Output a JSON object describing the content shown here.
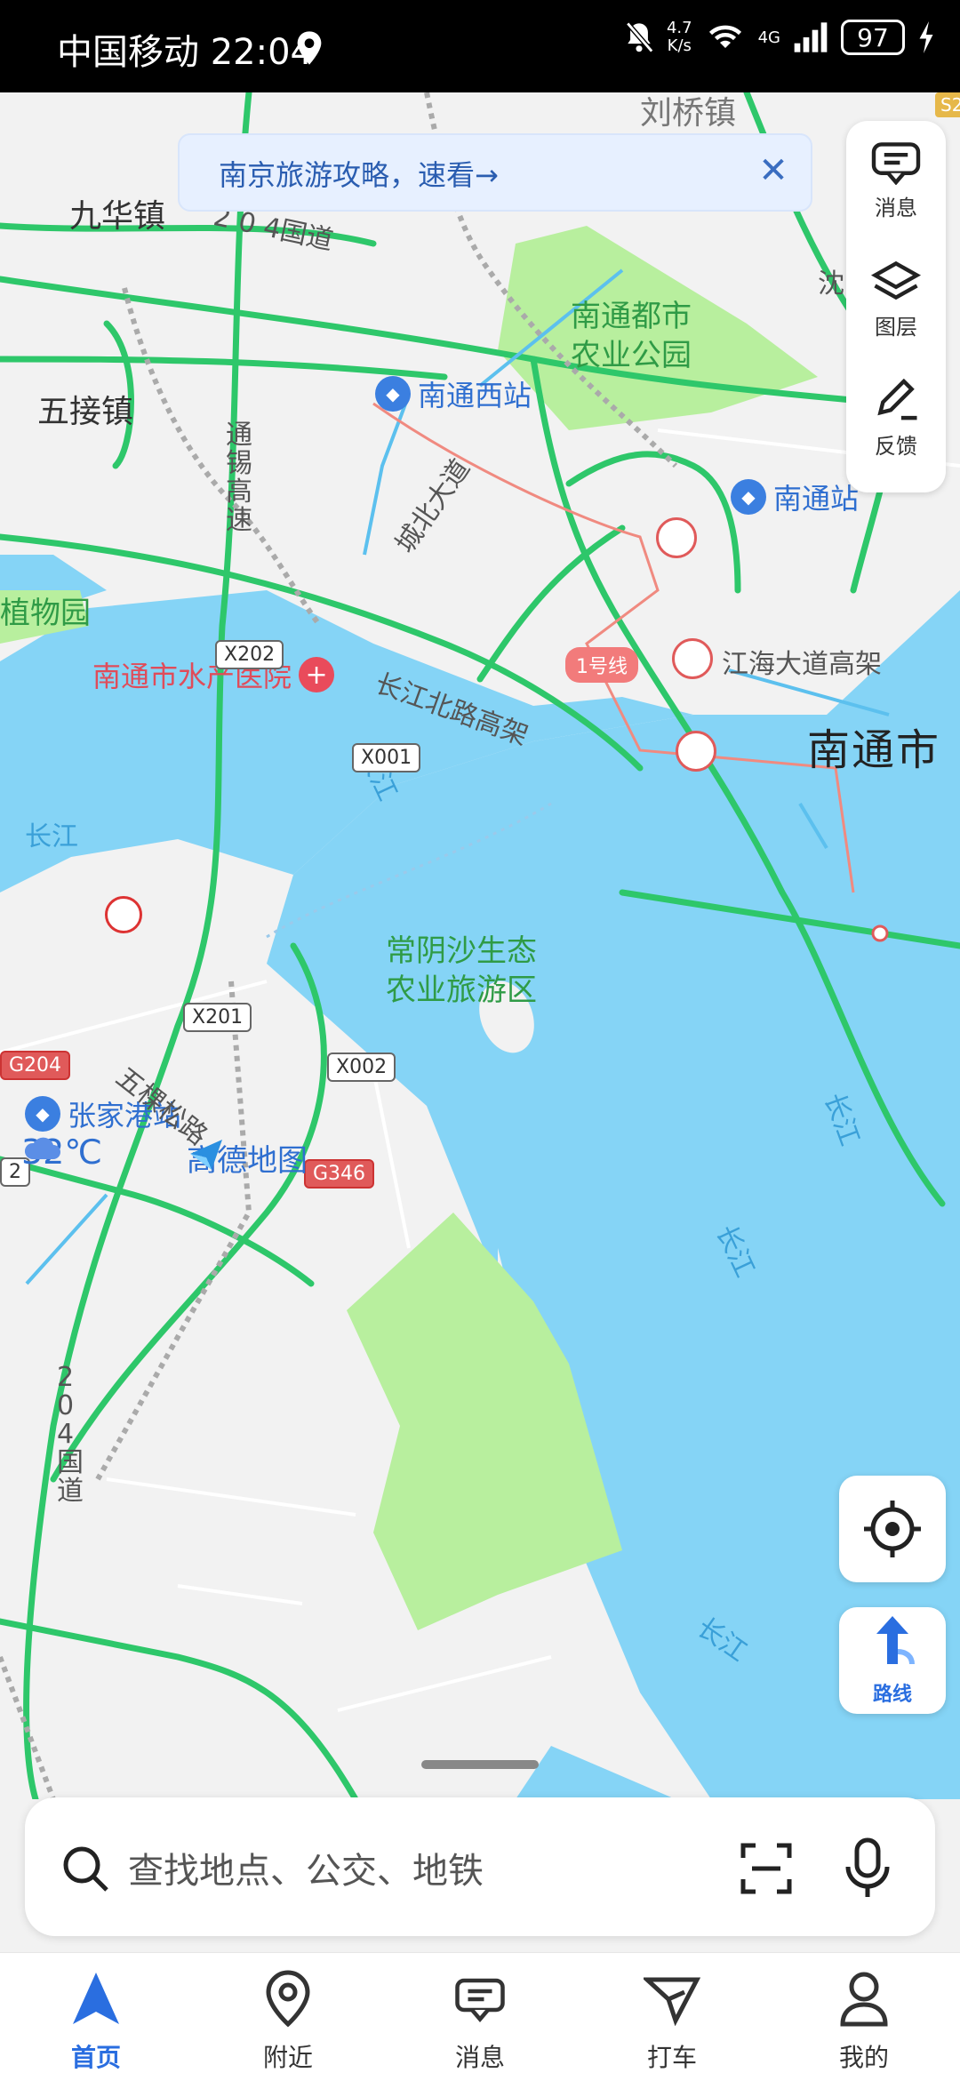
{
  "status_bar": {
    "carrier_time": "中国移动 22:04",
    "net_speed_value": "4.7",
    "net_speed_unit": "K/s",
    "network": "4G",
    "battery": "97"
  },
  "banner": {
    "text": "南京旅游攻略，速看→"
  },
  "side_panel": {
    "items": [
      {
        "label": "消息",
        "icon": "message-icon"
      },
      {
        "label": "图层",
        "icon": "layers-icon"
      },
      {
        "label": "反馈",
        "icon": "feedback-icon"
      }
    ]
  },
  "map": {
    "places": {
      "jiuhua": "九华镇",
      "wujie": "五接镇",
      "liuqiao": "刘桥镇",
      "nantong_city": "南通市"
    },
    "green_areas": {
      "dushi_1": "南通都市",
      "dushi_2": "农业公园",
      "changyin_1": "常阴沙生态",
      "changyin_2": "农业旅游区",
      "zhiwu": "植物园"
    },
    "stations": {
      "xi": "南通西站",
      "main": "南通站",
      "zhangjiagang": "张家港站"
    },
    "roads": {
      "g204_label": "2 0 4国道",
      "tongxi": "通\n锡\n高\n速",
      "chengbei": "城北大道",
      "changjiang_bei": "长江北路高架",
      "jianghai": "江海大道高架",
      "wukesong": "五棵松路",
      "g204_vertical": "2\n0\n4\n国\n道",
      "line1": "1号线",
      "side_s2": "S2",
      "side_yan": "沈"
    },
    "water": {
      "cj1": "长江",
      "cj2": "长江",
      "cj3": "长江",
      "cj4": "长江",
      "cj5": "长江"
    },
    "hospital": "南通市水产医院",
    "road_shields": {
      "x202": "X202",
      "x001": "X001",
      "x201": "X201",
      "x002": "X002",
      "g204": "G204",
      "g346": "G346",
      "edge2": "2"
    }
  },
  "overlay": {
    "temperature": "32℃",
    "brand": "高德地图"
  },
  "route_button": {
    "label": "路线"
  },
  "search": {
    "placeholder": "查找地点、公交、地铁"
  },
  "bottom_nav": {
    "items": [
      {
        "label": "首页",
        "icon": "navigation-arrow-icon",
        "active": true
      },
      {
        "label": "附近",
        "icon": "location-pin-icon"
      },
      {
        "label": "消息",
        "icon": "message-icon"
      },
      {
        "label": "打车",
        "icon": "taxi-icon"
      },
      {
        "label": "我的",
        "icon": "profile-icon"
      }
    ]
  },
  "colors": {
    "river": "#85d4f6",
    "land": "#f2f2f2",
    "park": "#b8ef9e",
    "road": "#2ec76a",
    "accent": "#2a6ee0"
  }
}
